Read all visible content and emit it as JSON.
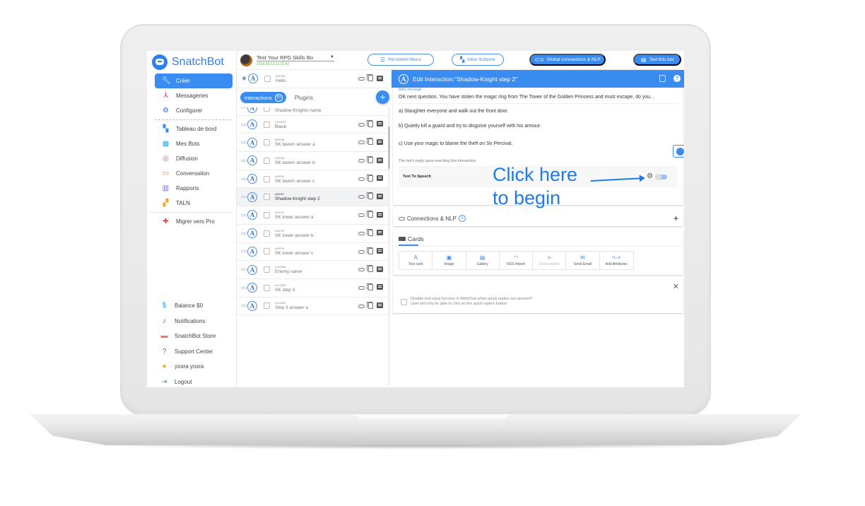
{
  "brand": {
    "name": "SnatchBot"
  },
  "sidebar": {
    "items": [
      {
        "label": "Créer",
        "icon": "wrench-icon",
        "active": true
      },
      {
        "label": "Messageries",
        "icon": "network-icon"
      },
      {
        "label": "Configurer",
        "icon": "gear-icon"
      },
      {
        "label": "Tableau de bord",
        "icon": "dashboard-icon"
      },
      {
        "label": "Mes Bots",
        "icon": "bots-icon"
      },
      {
        "label": "Diffusion",
        "icon": "broadcast-icon"
      },
      {
        "label": "Conversation",
        "icon": "chat-icon"
      },
      {
        "label": "Rapports",
        "icon": "chart-icon"
      },
      {
        "label": "TALN",
        "icon": "nlp-icon"
      },
      {
        "label": "Migrer vers Pro",
        "icon": "upgrade-icon"
      }
    ],
    "bottom": [
      {
        "label": "Balance $0",
        "icon": "dollar-icon"
      },
      {
        "label": "Notifications",
        "icon": "bell-icon"
      },
      {
        "label": "SnatchBot Store",
        "icon": "store-icon"
      },
      {
        "label": "Support Center",
        "icon": "help-icon"
      },
      {
        "label": "yosra yosra",
        "icon": "user-icon"
      },
      {
        "label": "Logout",
        "icon": "logout-icon"
      }
    ]
  },
  "topbar": {
    "bot_name": "Test Your RPG Skills Bo",
    "bot_date": "2018-08-13 22:22:42",
    "persistent_menu": "Persistent Menu",
    "view_scheme": "View Scheme",
    "global_connections": "Global connections & NLP",
    "test_bot": "Test this bot"
  },
  "list": {
    "pinned": {
      "id": "#95796",
      "name": "Hello"
    },
    "tabs": {
      "interactions": "Interactions",
      "count": "53",
      "plugins": "Plugins"
    },
    "peek": {
      "name": "Shadow-Knights name"
    },
    "rows": [
      {
        "id": "#116573",
        "name": "Black"
      },
      {
        "id": "#95788",
        "name": "SK tavern answer a"
      },
      {
        "id": "#95789",
        "name": "SK tavern answer b"
      },
      {
        "id": "#95790",
        "name": "SK tavern answer c"
      },
      {
        "id": "#95787",
        "name": "Shadow-Knight step 2",
        "selected": true
      },
      {
        "id": "#95791",
        "name": "SK tower answer a"
      },
      {
        "id": "#95792",
        "name": "SK tower answer b"
      },
      {
        "id": "#95795",
        "name": "SK tower answer c"
      },
      {
        "id": "#112556",
        "name": "Enemy name"
      },
      {
        "id": "#112555",
        "name": "SK step 3"
      },
      {
        "id": "#112662",
        "name": "Step 3 answer a"
      }
    ]
  },
  "edit": {
    "title": "Edit Interaction:\"Shadow-Knight step 2\"",
    "message_label": "Bot's message",
    "lines": [
      "OK next question. You have stolen the magic ring from The Tower of the Golden Princess and must escape, do you...",
      "a) Slaughter everyone and walk out the front door.",
      "b) Quietly kill a guard and try to disguise yourself with his armour.",
      "c) Use your magic to blame the theft on Sir Percival."
    ],
    "reply_hint": "The bot's reply upon reaching this interaction.",
    "tts_label": "Text To Speech",
    "tts_enabled": false,
    "callout_line1": "Click here",
    "callout_line2": "to begin",
    "connections_label": "Connections & NLP",
    "connections_count": "4",
    "cards_label": "Cards",
    "card_types": [
      {
        "label": "Text card",
        "icon": "A"
      },
      {
        "label": "Image",
        "icon": "▣"
      },
      {
        "label": "Gallery",
        "icon": "▤"
      },
      {
        "label": "RSS Import",
        "icon": "◠"
      },
      {
        "label": "Quick replies",
        "icon": "➤",
        "disabled": true
      },
      {
        "label": "Send Email",
        "icon": "✉"
      },
      {
        "label": "Add Attributes",
        "icon": "<·>"
      }
    ],
    "quick_reply_line1": "Disable text input function in WebChat when quick replies are present?",
    "quick_reply_line2": "User will only be able to click on the quick replies button"
  }
}
